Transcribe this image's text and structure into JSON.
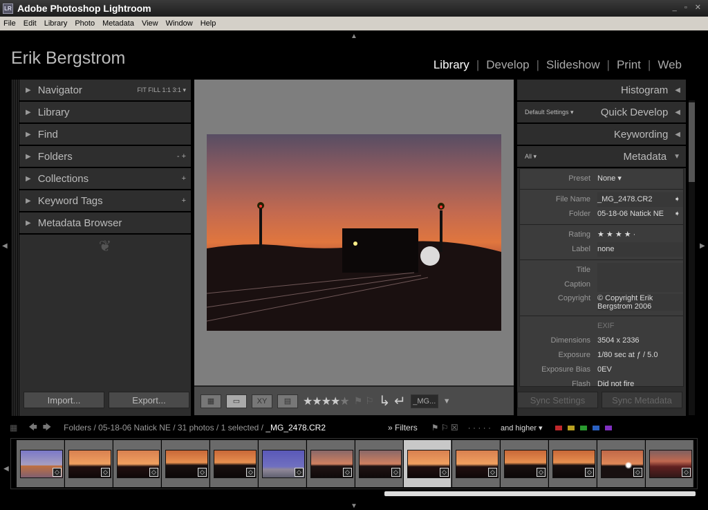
{
  "window": {
    "title": "Adobe Photoshop Lightroom",
    "logo": "LR"
  },
  "menu": [
    "File",
    "Edit",
    "Library",
    "Photo",
    "Metadata",
    "View",
    "Window",
    "Help"
  ],
  "identity_plate": "Erik Bergstrom",
  "modules": [
    {
      "label": "Library",
      "active": true
    },
    {
      "label": "Develop"
    },
    {
      "label": "Slideshow"
    },
    {
      "label": "Print"
    },
    {
      "label": "Web"
    }
  ],
  "left_panels": [
    {
      "label": "Navigator",
      "extra": "FIT   FILL   1:1   3:1 ▾"
    },
    {
      "label": "Library",
      "extra": ""
    },
    {
      "label": "Find",
      "extra": ""
    },
    {
      "label": "Folders",
      "extra": "-  +"
    },
    {
      "label": "Collections",
      "extra": "+"
    },
    {
      "label": "Keyword Tags",
      "extra": "+"
    },
    {
      "label": "Metadata Browser",
      "extra": ""
    }
  ],
  "left_buttons": {
    "import": "Import...",
    "export": "Export..."
  },
  "toolbar": {
    "rating_stars": 4,
    "filename": "_MG..."
  },
  "right_panels": {
    "histogram": "Histogram",
    "quick_develop": "Quick Develop",
    "quick_develop_preset": "Default Settings ▾",
    "keywording": "Keywording",
    "metadata": "Metadata",
    "metadata_preset": "All ▾"
  },
  "metadata": {
    "preset": {
      "k": "Preset",
      "v": "None ▾"
    },
    "file_name": {
      "k": "File Name",
      "v": "_MG_2478.CR2"
    },
    "folder": {
      "k": "Folder",
      "v": "05-18-06 Natick NE"
    },
    "rating": {
      "k": "Rating",
      "v": "★ ★ ★ ★ ·"
    },
    "label": {
      "k": "Label",
      "v": "none"
    },
    "title": {
      "k": "Title",
      "v": ""
    },
    "caption": {
      "k": "Caption",
      "v": ""
    },
    "copyright": {
      "k": "Copyright",
      "v": "© Copyright Erik Bergstrom 2006"
    },
    "exif_header": "EXIF",
    "dimensions": {
      "k": "Dimensions",
      "v": "3504 x 2336"
    },
    "exposure": {
      "k": "Exposure",
      "v": "1/80 sec at ƒ / 5.0"
    },
    "exposure_bias": {
      "k": "Exposure Bias",
      "v": "0EV"
    },
    "flash": {
      "k": "Flash",
      "v": "Did not fire"
    }
  },
  "right_buttons": {
    "sync_settings": "Sync Settings",
    "sync_metadata": "Sync Metadata"
  },
  "filterbar": {
    "path": "Folders / 05-18-06 Natick NE / 31 photos / 1 selected / ",
    "current": "_MG_2478.CR2",
    "filters": "» Filters",
    "rating_filter": "and higher ▾",
    "label_colors": [
      "#c0282c",
      "#b8a020",
      "#2a9a30",
      "#2a60c0",
      "#8030c0"
    ]
  },
  "filmstrip": {
    "selected_index": 8,
    "thumbs": [
      "blue-engine",
      "sunset-train",
      "sunset-train",
      "sunset-lights",
      "sunset-lights",
      "blue-train",
      "sunset-signals",
      "sunset-signals",
      "sunset-train",
      "sunset-train",
      "sunset-lights",
      "sunset-lights",
      "sunset-glow",
      "red-train"
    ]
  }
}
